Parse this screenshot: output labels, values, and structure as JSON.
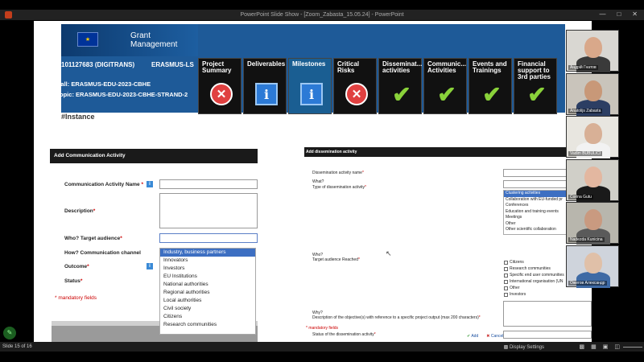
{
  "window": {
    "title": "PowerPoint Slide Show - [Zoom_Zabasta_15.05.24] - PowerPoint"
  },
  "banner": {
    "app_name": "Grant\nManagement",
    "project_id": "101127683 (DIGITRANS)",
    "program": "ERASMUS-LS",
    "call": "Call: ERASMUS-EDU-2023-CBHE",
    "topic": "Topic: ERASMUS-EDU-2023-CBHE-STRAND-2",
    "tiles": [
      {
        "label": "Project Summary",
        "icon": "x-icon",
        "status": "error"
      },
      {
        "label": "Deliverables",
        "icon": "info-icon",
        "status": "info"
      },
      {
        "label": "Milestones",
        "icon": "info-icon",
        "status": "info"
      },
      {
        "label": "Critical Risks",
        "icon": "x-icon",
        "status": "error"
      },
      {
        "label": "Disseminat... activities",
        "icon": "check-icon",
        "status": "ok"
      },
      {
        "label": "Communic... Activities",
        "icon": "check-icon",
        "status": "ok"
      },
      {
        "label": "Events and Trainings",
        "icon": "check-icon",
        "status": "ok"
      },
      {
        "label": "Financial support to 3rd parties",
        "icon": "check-icon",
        "status": "ok"
      }
    ],
    "partial_text": "#Instance"
  },
  "left_form": {
    "header": "Add Communication Activity",
    "name_label": "Communication Activity Name",
    "description_label": "Description",
    "target_label": "Who? Target audience",
    "channel_label": "How? Communication channel",
    "outcome_label": "Outcome",
    "status_label": "Status",
    "required_mark": "*",
    "mandatory_note": "* mandatory fields",
    "audience_options": [
      "Industry, business partners",
      "Innovators",
      "Investors",
      "EU Institutions",
      "National authorities",
      "Regional authorities",
      "Local authorities",
      "Civil society",
      "Citizens",
      "Research communities"
    ],
    "selected_audience": "Industry, business partners"
  },
  "right_form": {
    "header": "Add dissemination activity",
    "name_label": "Dissemination activity name",
    "what_label": "What?",
    "type_label": "Type of dissemination activity",
    "who_label": "Who?",
    "target_label": "Target audience Reached",
    "why_label": "Why?",
    "desc_label": "Description of the objective(s) with reference to a specific project output (max 200 characters)",
    "status_label": "Status of the dissemination activity",
    "required_mark": "*",
    "mandatory_note": "* mandatory fields",
    "add_label": "Add",
    "cancel_label": "Cancel",
    "type_options": [
      "Clustering activities",
      "Collaboration with EU-funded pr",
      "Conferences",
      "Education and training events",
      "Meetings",
      "Other",
      "Other scientific collaboration"
    ],
    "selected_type": "Clustering activities",
    "audience_checkboxes": [
      "Citizens",
      "Research communities",
      "Specific end user communities",
      "International organisation (UN",
      "Other",
      "Investors"
    ]
  },
  "participants": [
    {
      "name": "Андрій Гнатов"
    },
    {
      "name": "Anatolijs Zabasta"
    },
    {
      "name": "Vadim BUBULICI"
    },
    {
      "name": "Corina Gutu"
    },
    {
      "name": "Nadezda Kunicina"
    },
    {
      "name": "Ожегов Александр"
    }
  ],
  "statusbar": {
    "slide_info": "Slide 15 of 16",
    "display_settings": "Display Settings"
  },
  "colors": {
    "accent": "#1e5a98",
    "error": "#e04040",
    "ok": "#8ad23a",
    "info": "#2c7ad6",
    "selected": "#3d6fc2"
  }
}
